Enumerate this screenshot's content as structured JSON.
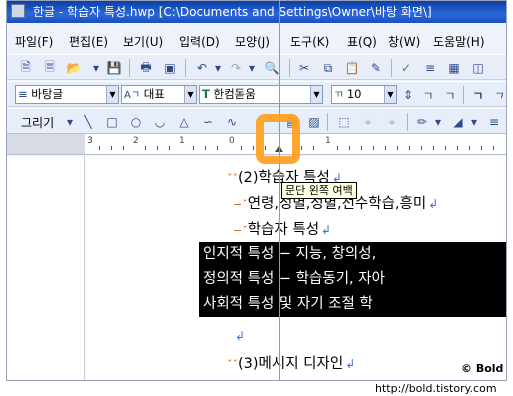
{
  "window": {
    "title": "한글 - 학습자 특성.hwp [C:\\Documents and Settings\\Owner\\바탕 화면\\]"
  },
  "menu": {
    "items": [
      "파일(F)",
      "편집(E)",
      "보기(U)",
      "입력(D)",
      "모양(J)",
      "도구(K)",
      "표(Q)",
      "창(W)",
      "도움말(H)"
    ]
  },
  "format_bar": {
    "style": "바탕글",
    "font_lang": "대표",
    "font_name": "한컴돋움",
    "font_size": "10",
    "font_icon": "truetype-font-icon"
  },
  "drawing_bar": {
    "draw_label": "그리기"
  },
  "ruler": {
    "numbers": [
      "3",
      "2",
      "1",
      "0",
      "1"
    ]
  },
  "document": {
    "lines": [
      {
        "prefix": "ˇˇ",
        "text": "(2)학습자 특성"
      },
      {
        "prefix": "−ˇ",
        "text": "연령,성별,성별,선수학습,흥미"
      },
      {
        "prefix": "−ˇ",
        "text": "학습자 특성"
      }
    ],
    "selected_lines": [
      "인지적 특성 − 지능, 창의성,",
      "정의적 특성 − 학습동기, 자아",
      "사회적 특성 및 자기 조절 학"
    ],
    "empty_mark": "↲",
    "last_line": {
      "prefix": "ˇˇ",
      "text": "(3)메시지 디자인"
    },
    "paragraph_mark": "↲"
  },
  "tooltip": {
    "text": "문단 왼쪽 여백"
  },
  "watermark": {
    "copyright": "© Bold"
  },
  "footer": {
    "url": "http://bold.tistory.com"
  },
  "colors": {
    "highlight": "#ff9d1a",
    "guide_line": "#2ec0e0",
    "selection_bg": "#000000"
  }
}
